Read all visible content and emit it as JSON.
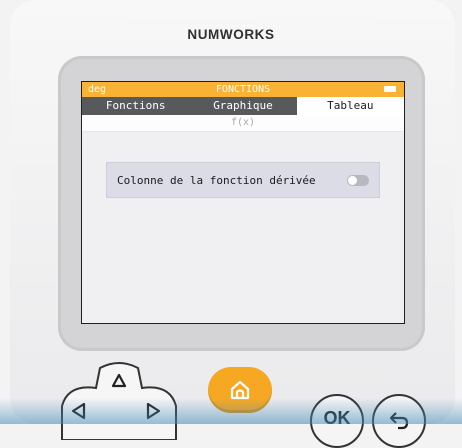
{
  "device": {
    "brand": "NUMWORKS"
  },
  "statusbar": {
    "mode": "deg",
    "title": "FONCTIONS",
    "battery_icon": "battery-full-icon"
  },
  "tabs": [
    {
      "label": "Fonctions",
      "active": false
    },
    {
      "label": "Graphique",
      "active": false
    },
    {
      "label": "Tableau",
      "active": true
    }
  ],
  "table": {
    "column_header": "f(x)"
  },
  "options": {
    "derivative_column_label": "Colonne de la fonction dérivée",
    "derivative_column_enabled": false
  },
  "keys": {
    "up_icon": "arrow-up-icon",
    "left_icon": "arrow-left-icon",
    "right_icon": "arrow-right-icon",
    "home_icon": "home-icon",
    "ok_label": "OK",
    "back_icon": "back-icon"
  },
  "colors": {
    "accent": "#f9b233",
    "tab_bar": "#58595b",
    "home_key": "#f7a823"
  }
}
